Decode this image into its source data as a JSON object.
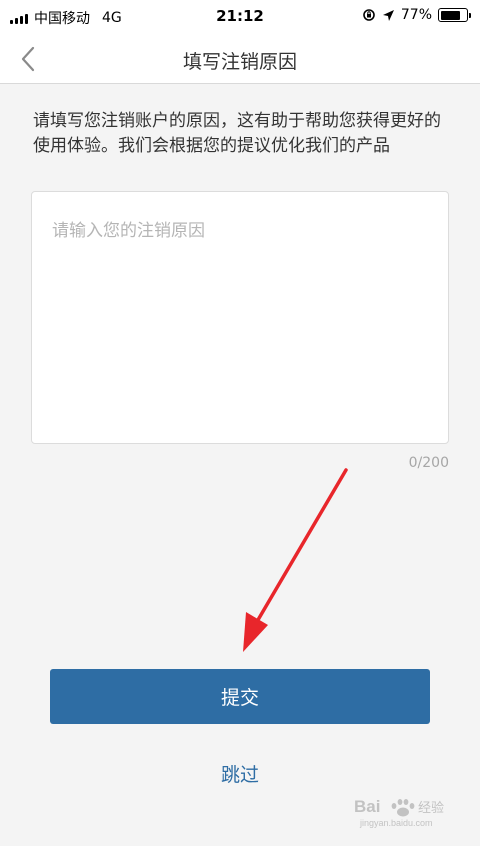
{
  "status_bar": {
    "carrier": "中国移动",
    "network": "4G",
    "time": "21:12",
    "battery_percent": "77%",
    "battery_level": 0.77
  },
  "nav": {
    "back_icon": "chevron-left-icon",
    "title": "填写注销原因"
  },
  "form": {
    "description": "请填写您注销账户的原因，这有助于帮助您获得更好的使用体验。我们会根据您的提议优化我们的产品",
    "reason_placeholder": "请输入您的注销原因",
    "reason_value": "",
    "char_counter": "0/200",
    "submit_label": "提交",
    "skip_label": "跳过"
  },
  "colors": {
    "primary": "#2e6da4",
    "annotation_arrow": "#e8262b",
    "background": "#f4f4f4"
  },
  "watermark": {
    "text": "Bai 经验",
    "subtext": "jingyan.baidu.com"
  }
}
